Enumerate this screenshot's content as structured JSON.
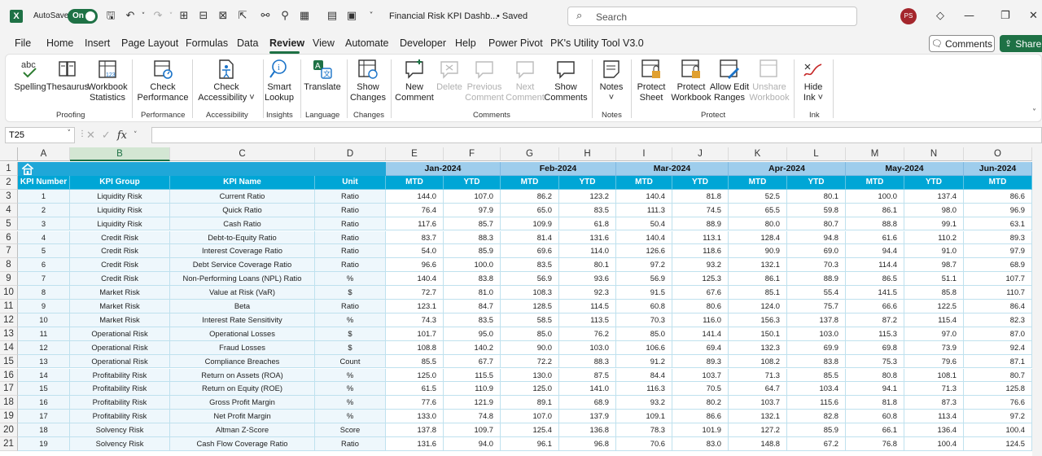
{
  "titlebar": {
    "app_logo": "X",
    "autosave_label": "AutoSave",
    "toggle_state": "On",
    "doc_title": "Financial Risk KPI Dashb...",
    "saved_status": "• Saved",
    "search_placeholder": "Search",
    "user_initials": "PS"
  },
  "menu": {
    "tabs": [
      "File",
      "Home",
      "Insert",
      "Page Layout",
      "Formulas",
      "Data",
      "Review",
      "View",
      "Automate",
      "Developer",
      "Help",
      "Power Pivot",
      "PK's Utility Tool V3.0"
    ],
    "active_tab": "Review",
    "comments_button": "Comments",
    "share_button": "Share"
  },
  "ribbon": {
    "groups": {
      "proofing": "Proofing",
      "performance": "Performance",
      "accessibility": "Accessibility",
      "insights": "Insights",
      "language": "Language",
      "changes": "Changes",
      "comments": "Comments",
      "notes": "Notes",
      "protect": "Protect",
      "ink": "Ink"
    },
    "buttons": {
      "spelling": "Spelling",
      "thesaurus": "Thesaurus",
      "workbook_statistics_1": "Workbook",
      "workbook_statistics_2": "Statistics",
      "check_performance_1": "Check",
      "check_performance_2": "Performance",
      "check_accessibility_1": "Check",
      "check_accessibility_2": "Accessibility ˅",
      "smart_lookup_1": "Smart",
      "smart_lookup_2": "Lookup",
      "translate": "Translate",
      "show_changes_1": "Show",
      "show_changes_2": "Changes",
      "new_comment_1": "New",
      "new_comment_2": "Comment",
      "delete": "Delete",
      "previous_comment_1": "Previous",
      "previous_comment_2": "Comment",
      "next_comment_1": "Next",
      "next_comment_2": "Comment",
      "show_comments_1": "Show",
      "show_comments_2": "Comments",
      "notes": "Notes",
      "notes_chev": "˅",
      "protect_sheet_1": "Protect",
      "protect_sheet_2": "Sheet",
      "protect_workbook_1": "Protect",
      "protect_workbook_2": "Workbook",
      "allow_edit_ranges_1": "Allow Edit",
      "allow_edit_ranges_2": "Ranges",
      "unshare_workbook_1": "Unshare",
      "unshare_workbook_2": "Workbook",
      "hide_ink_1": "Hide",
      "hide_ink_2": "Ink ˅"
    }
  },
  "formula_bar": {
    "name_box": "T25",
    "fx_label": "fx",
    "formula": ""
  },
  "sheet": {
    "columns": [
      "A",
      "B",
      "C",
      "D",
      "E",
      "F",
      "G",
      "H",
      "I",
      "J",
      "K",
      "L",
      "M",
      "N",
      "O"
    ],
    "selected_column": "B",
    "rows": [
      "1",
      "2",
      "3",
      "4",
      "5",
      "6",
      "7",
      "8",
      "9",
      "10",
      "11",
      "12",
      "13",
      "14",
      "15",
      "16",
      "17",
      "18",
      "19",
      "20",
      "21"
    ],
    "headers": [
      "KPI Number",
      "KPI Group",
      "KPI Name",
      "Unit"
    ],
    "months": [
      "Jan-2024",
      "Feb-2024",
      "Mar-2024",
      "Apr-2024",
      "May-2024",
      "Jun-2024"
    ],
    "mtd_label": "MTD",
    "ytd_label": "YTD",
    "data": [
      [
        "1",
        "Liquidity Risk",
        "Current Ratio",
        "Ratio",
        "144.0",
        "107.0",
        "86.2",
        "123.2",
        "140.4",
        "81.8",
        "52.5",
        "80.1",
        "100.0",
        "137.4",
        "86.6"
      ],
      [
        "2",
        "Liquidity Risk",
        "Quick Ratio",
        "Ratio",
        "76.4",
        "97.9",
        "65.0",
        "83.5",
        "111.3",
        "74.5",
        "65.5",
        "59.8",
        "86.1",
        "98.0",
        "96.9"
      ],
      [
        "3",
        "Liquidity Risk",
        "Cash Ratio",
        "Ratio",
        "117.6",
        "85.7",
        "109.9",
        "61.8",
        "50.4",
        "88.9",
        "80.0",
        "80.7",
        "88.8",
        "99.1",
        "63.1"
      ],
      [
        "4",
        "Credit Risk",
        "Debt-to-Equity Ratio",
        "Ratio",
        "83.7",
        "88.3",
        "81.4",
        "131.6",
        "140.4",
        "113.1",
        "128.4",
        "94.8",
        "61.6",
        "110.2",
        "89.3"
      ],
      [
        "5",
        "Credit Risk",
        "Interest Coverage Ratio",
        "Ratio",
        "54.0",
        "85.9",
        "69.6",
        "114.0",
        "126.6",
        "118.6",
        "90.9",
        "69.0",
        "94.4",
        "91.0",
        "97.9"
      ],
      [
        "6",
        "Credit Risk",
        "Debt Service Coverage Ratio",
        "Ratio",
        "96.6",
        "100.0",
        "83.5",
        "80.1",
        "97.2",
        "93.2",
        "132.1",
        "70.3",
        "114.4",
        "98.7",
        "68.9"
      ],
      [
        "7",
        "Credit Risk",
        "Non-Performing Loans (NPL) Ratio",
        "%",
        "140.4",
        "83.8",
        "56.9",
        "93.6",
        "56.9",
        "125.3",
        "86.1",
        "88.9",
        "86.5",
        "51.1",
        "107.7"
      ],
      [
        "8",
        "Market Risk",
        "Value at Risk (VaR)",
        "$",
        "72.7",
        "81.0",
        "108.3",
        "92.3",
        "91.5",
        "67.6",
        "85.1",
        "55.4",
        "141.5",
        "85.8",
        "110.7"
      ],
      [
        "9",
        "Market Risk",
        "Beta",
        "Ratio",
        "123.1",
        "84.7",
        "128.5",
        "114.5",
        "60.8",
        "80.6",
        "124.0",
        "75.7",
        "66.6",
        "122.5",
        "86.4"
      ],
      [
        "10",
        "Market Risk",
        "Interest Rate Sensitivity",
        "%",
        "74.3",
        "83.5",
        "58.5",
        "113.5",
        "70.3",
        "116.0",
        "156.3",
        "137.8",
        "87.2",
        "115.4",
        "82.3"
      ],
      [
        "11",
        "Operational Risk",
        "Operational Losses",
        "$",
        "101.7",
        "95.0",
        "85.0",
        "76.2",
        "85.0",
        "141.4",
        "150.1",
        "103.0",
        "115.3",
        "97.0",
        "87.0"
      ],
      [
        "12",
        "Operational Risk",
        "Fraud Losses",
        "$",
        "108.8",
        "140.2",
        "90.0",
        "103.0",
        "106.6",
        "69.4",
        "132.3",
        "69.9",
        "69.8",
        "73.9",
        "92.4"
      ],
      [
        "13",
        "Operational Risk",
        "Compliance Breaches",
        "Count",
        "85.5",
        "67.7",
        "72.2",
        "88.3",
        "91.2",
        "89.3",
        "108.2",
        "83.8",
        "75.3",
        "79.6",
        "87.1"
      ],
      [
        "14",
        "Profitability Risk",
        "Return on Assets (ROA)",
        "%",
        "125.0",
        "115.5",
        "130.0",
        "87.5",
        "84.4",
        "103.7",
        "71.3",
        "85.5",
        "80.8",
        "108.1",
        "80.7"
      ],
      [
        "15",
        "Profitability Risk",
        "Return on Equity (ROE)",
        "%",
        "61.5",
        "110.9",
        "125.0",
        "141.0",
        "116.3",
        "70.5",
        "64.7",
        "103.4",
        "94.1",
        "71.3",
        "125.8"
      ],
      [
        "16",
        "Profitability Risk",
        "Gross Profit Margin",
        "%",
        "77.6",
        "121.9",
        "89.1",
        "68.9",
        "93.2",
        "80.2",
        "103.7",
        "115.6",
        "81.8",
        "87.3",
        "76.6"
      ],
      [
        "17",
        "Profitability Risk",
        "Net Profit Margin",
        "%",
        "133.0",
        "74.8",
        "107.0",
        "137.9",
        "109.1",
        "86.6",
        "132.1",
        "82.8",
        "60.8",
        "113.4",
        "97.2"
      ],
      [
        "18",
        "Solvency Risk",
        "Altman Z-Score",
        "Score",
        "137.8",
        "109.7",
        "125.4",
        "136.8",
        "78.3",
        "101.9",
        "127.2",
        "85.9",
        "66.1",
        "136.4",
        "100.4"
      ],
      [
        "19",
        "Solvency Risk",
        "Cash Flow Coverage Ratio",
        "Ratio",
        "131.6",
        "94.0",
        "96.1",
        "96.8",
        "70.6",
        "83.0",
        "148.8",
        "67.2",
        "76.8",
        "100.4",
        "124.5"
      ]
    ]
  },
  "icons": {
    "home": "home-icon",
    "search": "search-icon"
  },
  "colors": {
    "excel_green": "#1e7145",
    "header_blue": "#00a6d6",
    "month_blue": "#9ecdec",
    "avatar_red": "#a4262c"
  }
}
